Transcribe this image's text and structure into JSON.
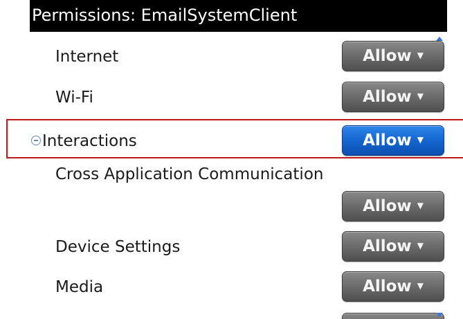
{
  "screen": {
    "title": "Permissions: EmailSystemClient"
  },
  "rows": [
    {
      "label": "Internet",
      "value": "Allow"
    },
    {
      "label": "Wi-Fi",
      "value": "Allow"
    },
    {
      "label": "Interactions",
      "value": "Allow"
    },
    {
      "label": "Cross Application Communication",
      "value": "Allow"
    },
    {
      "label": "Device Settings",
      "value": "Allow"
    },
    {
      "label": "Media",
      "value": "Allow"
    }
  ],
  "icons": {
    "caret": "▼",
    "collapse": "minus-circle-icon",
    "scroll_up": "scroll-up-arrow-icon",
    "scroll_down": "scroll-down-arrow-icon"
  },
  "colors": {
    "title_bg": "#000000",
    "button_gray": "#6e6e6e",
    "button_selected": "#1566d0",
    "highlight": "#c01818"
  }
}
